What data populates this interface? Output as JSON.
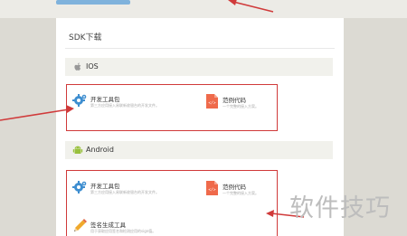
{
  "page": {
    "title": "SDK下载",
    "watermark": "软件技巧"
  },
  "ios": {
    "name": "IOS",
    "items": [
      {
        "name": "开发工具包",
        "desc": "第三方应用接入易联新收银台的开发文件。"
      },
      {
        "name": "范例代码",
        "desc": "一个完整的接入方案。"
      }
    ]
  },
  "android": {
    "name": "Android",
    "items": [
      {
        "name": "开发工具包",
        "desc": "第三方应用接入易联新收银台的开发文件。"
      },
      {
        "name": "范例代码",
        "desc": "一个完整的接入方案。"
      },
      {
        "name": "签名生成工具",
        "desc": "用于获取应用签名和检测应用的sign值。"
      }
    ]
  },
  "colors": {
    "highlight": "#d03a3a",
    "gear": "#3e8ed0",
    "code": "#ef6a4b",
    "pencil": "#f0a92c",
    "android": "#98c03c"
  }
}
